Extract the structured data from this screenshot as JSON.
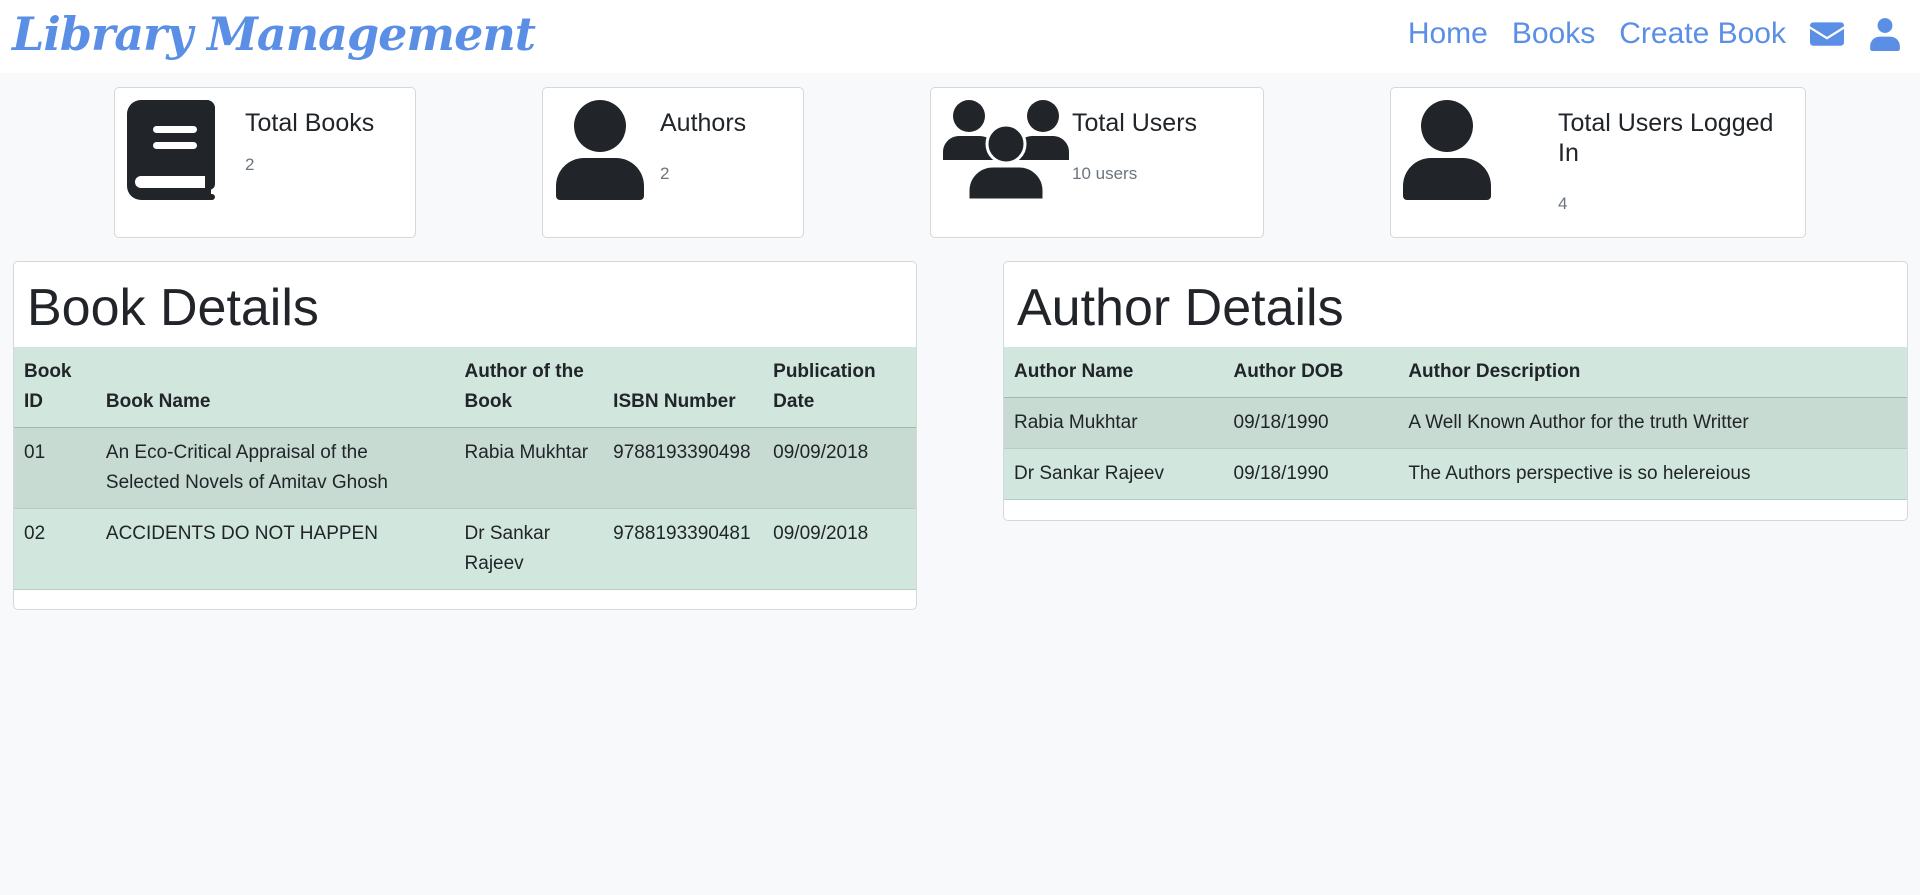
{
  "navbar": {
    "brand": "Library Management",
    "links": [
      "Home",
      "Books",
      "Create Book"
    ],
    "icons": [
      "envelope-icon",
      "user-icon"
    ],
    "accent_color": "#5b8fe6"
  },
  "stats": [
    {
      "title": "Total Books",
      "value": "2",
      "icon": "book-icon"
    },
    {
      "title": "Authors",
      "value": "2",
      "icon": "user-icon"
    },
    {
      "title": "Total Users",
      "value": "10 users",
      "icon": "users-group-icon"
    },
    {
      "title": "Total Users Logged In",
      "value": "4",
      "icon": "user-icon"
    }
  ],
  "book_details": {
    "title": "Book Details",
    "columns": [
      "Book ID",
      "Book Name",
      "Author of the Book",
      "ISBN Number",
      "Publication Date"
    ],
    "rows": [
      [
        "01",
        "An Eco-Critical Appraisal of the Selected Novels of Amitav Ghosh",
        "Rabia Mukhtar",
        "9788193390498",
        "09/09/2018"
      ],
      [
        "02",
        "ACCIDENTS DO NOT HAPPEN",
        "Dr Sankar Rajeev",
        "9788193390481",
        "09/09/2018"
      ]
    ]
  },
  "author_details": {
    "title": "Author Details",
    "columns": [
      "Author Name",
      "Author DOB",
      "Author Description"
    ],
    "rows": [
      [
        "Rabia Mukhtar",
        "09/18/1990",
        "A Well Known Author for the truth Writter"
      ],
      [
        "Dr Sankar Rajeev",
        "09/18/1990",
        "The Authors perspective is so helereious"
      ]
    ]
  },
  "colors": {
    "table_bg": "#d1e7dd",
    "table_stripe": "#c7dbd2",
    "page_bg": "#f8f9fa"
  }
}
